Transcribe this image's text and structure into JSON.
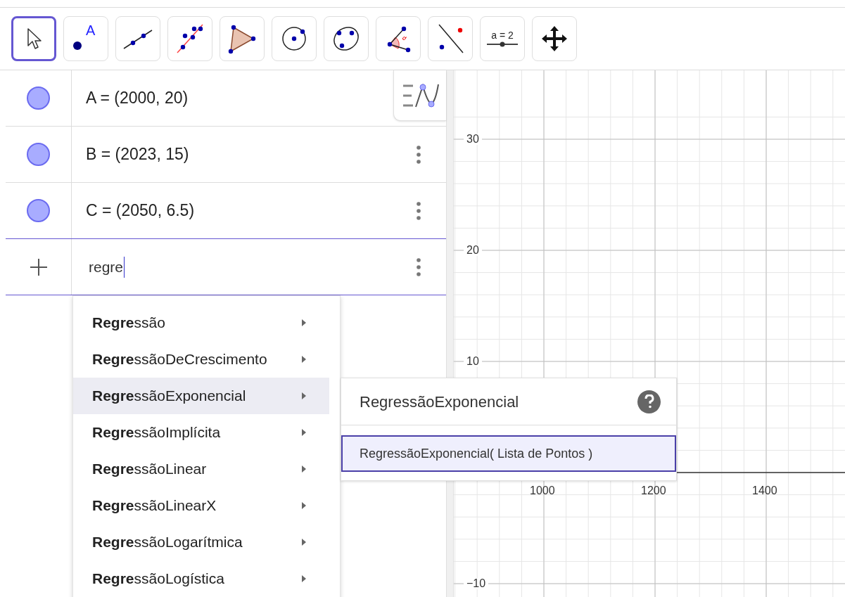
{
  "toolbar": {
    "tools": [
      {
        "kind": "move",
        "selected": true
      },
      {
        "kind": "point",
        "label": "A",
        "selected": false
      },
      {
        "kind": "line",
        "selected": false
      },
      {
        "kind": "fit-line",
        "selected": false
      },
      {
        "kind": "polygon",
        "selected": false
      },
      {
        "kind": "circle",
        "selected": false
      },
      {
        "kind": "conic",
        "selected": false
      },
      {
        "kind": "angle",
        "selected": false
      },
      {
        "kind": "reflect",
        "selected": false
      },
      {
        "kind": "slider",
        "label": "a = 2",
        "selected": false
      },
      {
        "kind": "move-view",
        "selected": false
      }
    ]
  },
  "algebra": {
    "rows": [
      {
        "label": "A = (2000, 20)",
        "visible": true
      },
      {
        "label": "B = (2023, 15)",
        "visible": true
      },
      {
        "label": "C = (2050, 6.5)",
        "visible": true
      }
    ],
    "input": {
      "value": "regre"
    }
  },
  "suggestions": [
    {
      "text": "**Regre**ssão",
      "selected": false
    },
    {
      "text": "**Regre**ssãoDeCrescimento",
      "selected": false
    },
    {
      "text": "**Regre**ssãoExponencial",
      "selected": true
    },
    {
      "text": "**Regre**ssãoImplícita",
      "selected": false
    },
    {
      "text": "**Regre**ssãoLinear",
      "selected": false
    },
    {
      "text": "**Regre**ssãoLinearX",
      "selected": false
    },
    {
      "text": "**Regre**ssãoLogarítmica",
      "selected": false
    },
    {
      "text": "**Regre**ssãoLogística",
      "selected": false
    }
  ],
  "syntax_popup": {
    "title": "RegressãoExponencial",
    "syntaxes": [
      {
        "text": "RegressãoExponencial( Lista de Pontos )",
        "selected": true
      }
    ]
  },
  "graphics": {
    "y_labels": [
      "30",
      "20",
      "10",
      "−10"
    ],
    "x_labels": [
      "1000",
      "1200",
      "1400"
    ]
  }
}
